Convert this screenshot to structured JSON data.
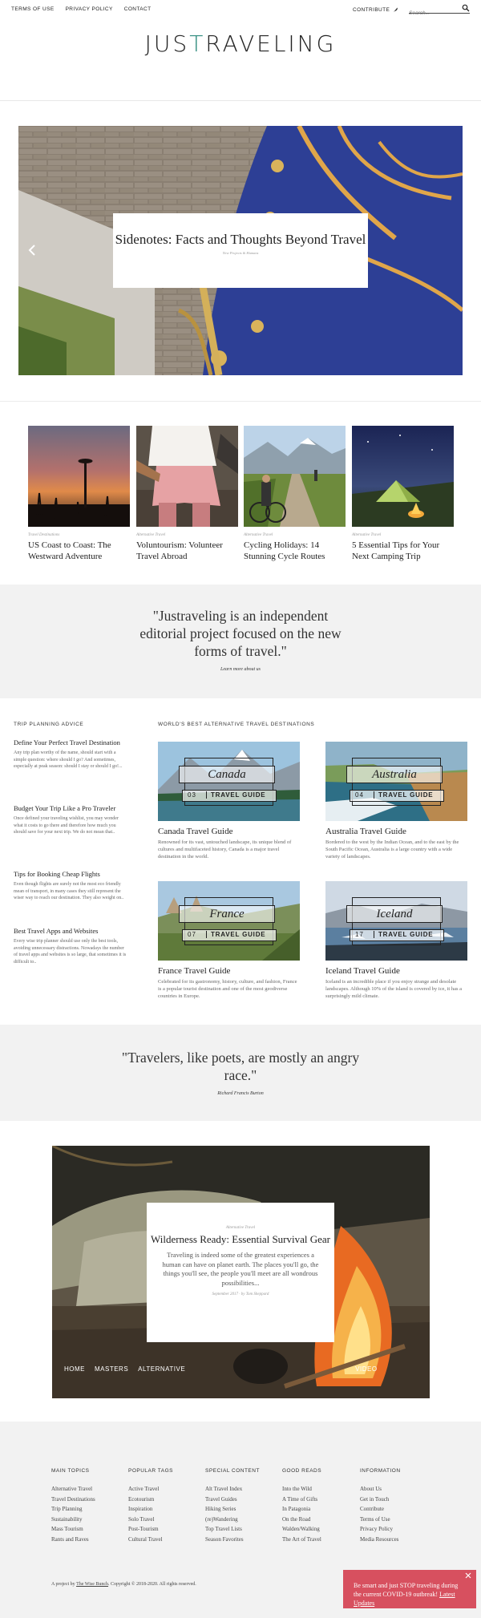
{
  "topbar": {
    "links": [
      "TERMS OF USE",
      "PRIVACY POLICY",
      "CONTACT"
    ],
    "contribute": "CONTRIBUTE",
    "search_placeholder": "Search..."
  },
  "logo": {
    "text_left": "JUS",
    "text_mark": "T",
    "text_right": "RAVELING"
  },
  "hero": {
    "title": "Sidenotes: Facts and Thoughts Beyond Travel",
    "meta": "New Projects & Humans"
  },
  "grid": [
    {
      "category": "Travel Destinations",
      "title": "US Coast to Coast: The Westward Adventure"
    },
    {
      "category": "Alternative Travel",
      "title": "Voluntourism: Volunteer Travel Abroad"
    },
    {
      "category": "Alternative Travel",
      "title": "Cycling Holidays: 14 Stunning Cycle Routes"
    },
    {
      "category": "Alternative Travel",
      "title": "5 Essential Tips for Your Next Camping Trip"
    }
  ],
  "about": {
    "quote": "\"Justraveling is an independent editorial project focused on the new forms of travel.\"",
    "link": "Learn more about us"
  },
  "advice": {
    "heading": "TRIP PLANNING ADVICE",
    "items": [
      {
        "title": "Define Your Perfect Travel Destination",
        "desc": "Any trip plan worthy of the name, should start with a simple question: where should I go? And sometimes, especially at peak season: should I stay or should I go!..."
      },
      {
        "title": "Budget Your Trip Like a Pro Traveler",
        "desc": "Once defined your traveling wishlist, you may wonder what it costs to go there and therefore how much you should save for your next trip. We do not mean that.."
      },
      {
        "title": "Tips for Booking Cheap Flights",
        "desc": "Even though flights are surely not the most eco friendly mean of transport, in many cases they still represent the wiser way to reach our destination. They also weight on.."
      },
      {
        "title": "Best Travel Apps and Websites",
        "desc": "Every wise trip planner should use only the best tools, avoiding unnecessary distractions. Nowadays the number of travel apps and websites is so large, that sometimes it is difficult to.."
      }
    ]
  },
  "destinations": {
    "heading": "WORLD'S BEST ALTERNATIVE TRAVEL DESTINATIONS",
    "guide_label": "TRAVEL GUIDE",
    "items": [
      {
        "name": "Canada",
        "num": "03",
        "title": "Canada Travel Guide",
        "desc": "Renowned for its vast, untouched landscape, its unique blend of cultures and multifaceted history, Canada is a major travel destination in the world."
      },
      {
        "name": "Australia",
        "num": "04",
        "title": "Australia Travel Guide",
        "desc": "Bordered to the west by the Indian Ocean, and to the east by the South Pacific Ocean, Australia is a large country with a wide variety of landscapes."
      },
      {
        "name": "France",
        "num": "07",
        "title": "France Travel Guide",
        "desc": "Celebrated for its gastronomy, history, culture, and fashion, France is a popular tourist destination and one of the most geodiverse countries in Europe."
      },
      {
        "name": "Iceland",
        "num": "17",
        "title": "Iceland Travel Guide",
        "desc": "Iceland is an incredible place if you enjoy strange and desolate landscapes. Although 10% of the island is covered by ice, it has a surprisingly mild climate."
      }
    ]
  },
  "quote2": {
    "text": "\"Travelers, like poets, are mostly an angry race.\"",
    "author": "Richard Francis Burton"
  },
  "feature": {
    "category": "Alternative Travel",
    "title": "Wilderness Ready: Essential Survival Gear",
    "excerpt": "Traveling is indeed some of the greatest experiences a human can have on planet earth. The places you'll go, the things you'll see, the people you'll meet are all wondrous possibilities...",
    "meta": "September 2017 · by Tom Sheppard",
    "crumbs": [
      "HOME",
      "MASTERS",
      "ALTERNATIVE",
      "VIDEO"
    ]
  },
  "footer": {
    "columns": [
      {
        "heading": "MAIN TOPICS",
        "links": [
          "Alternative Travel",
          "Travel Destinations",
          "Trip Planning",
          "Sustainability",
          "Mass Tourism",
          "Rants and Raves"
        ]
      },
      {
        "heading": "POPULAR TAGS",
        "links": [
          "Active Travel",
          "Ecotourism",
          "Inspiration",
          "Solo Travel",
          "Post-Tourism",
          "Cultural Travel"
        ]
      },
      {
        "heading": "SPECIAL CONTENT",
        "links": [
          "Alt Travel Index",
          "Travel Guides",
          "Hiking Series",
          "(re)Wandering",
          "Top Travel Lists",
          "Season Favorites"
        ]
      },
      {
        "heading": "GOOD READS",
        "links": [
          "Into the Wild",
          "A Time of Gifts",
          "In Patagonia",
          "On the Road",
          "Walden/Walking",
          "The Art of Travel"
        ]
      },
      {
        "heading": "INFORMATION",
        "links": [
          "About Us",
          "Get in Touch",
          "Contribute",
          "Terms of Use",
          "Privacy Policy",
          "Media Resources"
        ]
      }
    ],
    "credit_prefix": "A project by ",
    "credit_link": "The Wise Bunch",
    "credit_suffix": ". Copyright © 2018-2020. All rights reserved."
  },
  "toast": {
    "message": "Be smart and just STOP traveling during the current COVID-19 outbreak! ",
    "link": "Latest Updates"
  },
  "colors": {
    "accent": "#2e8b7d",
    "toast": "#d7505f",
    "band": "#f2f2f2"
  }
}
